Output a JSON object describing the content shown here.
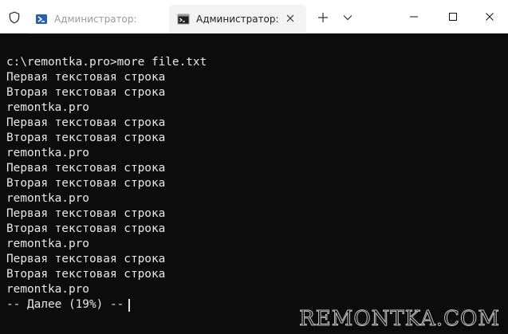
{
  "tabs": [
    {
      "title": "Администратор: W",
      "icon": "powershell-icon",
      "active": false
    },
    {
      "title": "Администратор: C",
      "icon": "cmd-icon",
      "active": true
    }
  ],
  "terminal": {
    "lines": [
      "c:\\remontka.pro>more file.txt",
      "Первая текстовая строка",
      "Вторая текстовая строка",
      "remontka.pro",
      "Первая текстовая строка",
      "Вторая текстовая строка",
      "remontka.pro",
      "Первая текстовая строка",
      "Вторая текстовая строка",
      "remontka.pro",
      "Первая текстовая строка",
      "Вторая текстовая строка",
      "remontka.pro",
      "Первая текстовая строка",
      "Вторая текстовая строка",
      "remontka.pro"
    ],
    "more_prompt": "-- Далее (19%) --"
  },
  "watermark": "REMONTKA.COM",
  "colors": {
    "terminal_bg": "#0c0c0c",
    "terminal_text": "#e8e8e8",
    "powershell_blue": "#2b5fa8"
  }
}
